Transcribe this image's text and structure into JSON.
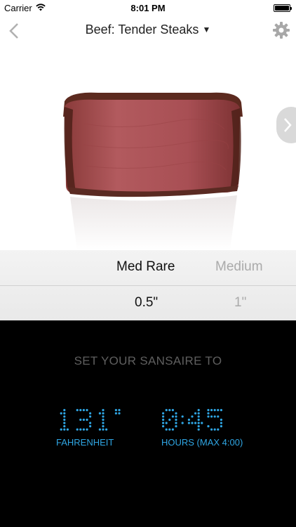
{
  "status_bar": {
    "carrier": "Carrier",
    "time": "8:01 PM"
  },
  "nav": {
    "title": "Beef: Tender Steaks",
    "caret": "▼"
  },
  "picker": {
    "doneness": {
      "selected": "Med Rare",
      "next": "Medium"
    },
    "thickness": {
      "selected": "0.5\"",
      "next": "1\""
    }
  },
  "panel": {
    "heading": "SET YOUR SANSAIRE TO",
    "temperature": {
      "value": "131°",
      "unit": "FAHRENHEIT"
    },
    "time": {
      "value": "0:45",
      "unit": "HOURS (MAX 4:00)"
    }
  },
  "colors": {
    "accent": "#2fa6e4",
    "panel_bg": "#000000",
    "dim_text": "#5f5f5f"
  },
  "icons": {
    "back": "chevron-left-icon",
    "settings": "gear-icon",
    "next": "chevron-right-icon",
    "wifi": "wifi-icon",
    "battery": "battery-icon"
  }
}
